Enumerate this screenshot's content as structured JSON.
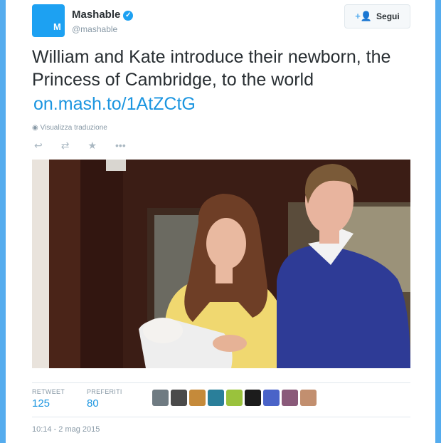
{
  "account": {
    "name": "Mashable",
    "handle": "@mashable",
    "avatar_letter": "M",
    "verified_icon": "verified-badge-icon"
  },
  "follow_button": {
    "label": "Segui",
    "icon": "follow-person-icon"
  },
  "tweet": {
    "text": "William and Kate introduce their newborn, the Princess of Cambridge, to the world",
    "link": "on.mash.to/1AtZCtG",
    "translate_label": "Visualizza traduzione",
    "translate_icon": "globe-icon"
  },
  "actions": [
    {
      "name": "reply",
      "icon": "reply-icon"
    },
    {
      "name": "retweet",
      "icon": "retweet-icon"
    },
    {
      "name": "favorite",
      "icon": "star-icon"
    },
    {
      "name": "more",
      "icon": "more-icon"
    }
  ],
  "stats": {
    "retweet_label": "RETWEET",
    "retweet_count": "125",
    "favorite_label": "PREFERITI",
    "favorite_count": "80"
  },
  "timestamp": "10:14 - 2 mag 2015",
  "colors": {
    "brand_blue": "#1da1f2",
    "link_blue": "#1b95e0",
    "page_background": "#55acee"
  }
}
